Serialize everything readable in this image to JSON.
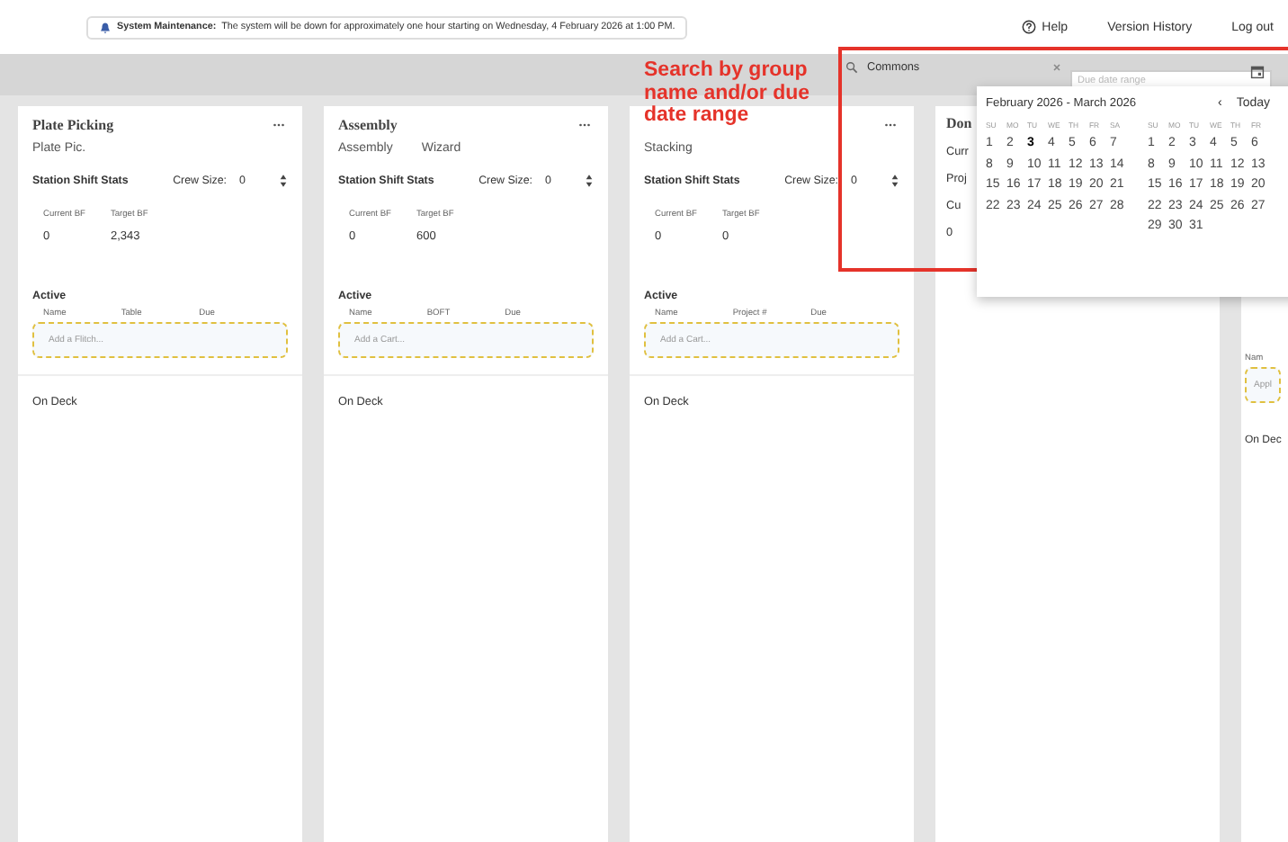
{
  "notice": {
    "label": "System Maintenance:",
    "text": "The system will be down for approximately one hour starting on Wednesday, 4 February 2026 at 1:00 PM."
  },
  "nav": [
    "Help",
    "Version History",
    "Log out"
  ],
  "annotation": "Search by group name and/or due date range",
  "search": {
    "value": "Commons"
  },
  "date_range": {
    "placeholder": "Due date range"
  },
  "calendar": {
    "title": "February 2026 - March 2026",
    "prev": "‹",
    "today": "Today",
    "months": [
      {
        "weekdays": [
          "SU",
          "MO",
          "TU",
          "WE",
          "TH",
          "FR",
          "SA"
        ],
        "weeks": [
          [
            {
              "d": "1",
              "today": false
            },
            {
              "d": "2",
              "today": false
            },
            {
              "d": "3",
              "today": true
            },
            {
              "d": "4",
              "today": false
            },
            {
              "d": "5",
              "today": false
            },
            {
              "d": "6",
              "today": false
            },
            {
              "d": "7",
              "today": false
            }
          ],
          [
            {
              "d": "8",
              "today": false
            },
            {
              "d": "9",
              "today": false
            },
            {
              "d": "10",
              "today": false
            },
            {
              "d": "11",
              "today": false
            },
            {
              "d": "12",
              "today": false
            },
            {
              "d": "13",
              "today": false
            },
            {
              "d": "14",
              "today": false
            }
          ],
          [
            {
              "d": "15",
              "today": false
            },
            {
              "d": "16",
              "today": false
            },
            {
              "d": "17",
              "today": false
            },
            {
              "d": "18",
              "today": false
            },
            {
              "d": "19",
              "today": false
            },
            {
              "d": "20",
              "today": false
            },
            {
              "d": "21",
              "today": false
            }
          ],
          [
            {
              "d": "22",
              "today": false
            },
            {
              "d": "23",
              "today": false
            },
            {
              "d": "24",
              "today": false
            },
            {
              "d": "25",
              "today": false
            },
            {
              "d": "26",
              "today": false
            },
            {
              "d": "27",
              "today": false
            },
            {
              "d": "28",
              "today": false
            }
          ]
        ]
      },
      {
        "weekdays": [
          "SU",
          "MO",
          "TU",
          "WE",
          "TH",
          "FR"
        ],
        "weeks": [
          [
            {
              "d": "1",
              "today": false
            },
            {
              "d": "2",
              "today": false
            },
            {
              "d": "3",
              "today": false
            },
            {
              "d": "4",
              "today": false
            },
            {
              "d": "5",
              "today": false
            },
            {
              "d": "6",
              "today": false
            }
          ],
          [
            {
              "d": "8",
              "today": false
            },
            {
              "d": "9",
              "today": false
            },
            {
              "d": "10",
              "today": false
            },
            {
              "d": "11",
              "today": false
            },
            {
              "d": "12",
              "today": false
            },
            {
              "d": "13",
              "today": false
            }
          ],
          [
            {
              "d": "15",
              "today": false
            },
            {
              "d": "16",
              "today": false
            },
            {
              "d": "17",
              "today": false
            },
            {
              "d": "18",
              "today": false
            },
            {
              "d": "19",
              "today": false
            },
            {
              "d": "20",
              "today": false
            }
          ],
          [
            {
              "d": "22",
              "today": false
            },
            {
              "d": "23",
              "today": false
            },
            {
              "d": "24",
              "today": false
            },
            {
              "d": "25",
              "today": false
            },
            {
              "d": "26",
              "today": false
            },
            {
              "d": "27",
              "today": false
            }
          ],
          [
            {
              "d": "29",
              "today": false
            },
            {
              "d": "30",
              "today": false
            },
            {
              "d": "31",
              "today": false
            }
          ]
        ]
      }
    ]
  },
  "columns": [
    {
      "kind": "full",
      "title": "Plate Picking",
      "tabs": [
        "Plate Pic."
      ],
      "stats_title": "Station Shift Stats",
      "crew_label": "Crew Size:",
      "crew_value": "0",
      "stats": [
        {
          "label": "Current BF",
          "value": "0"
        },
        {
          "label": "Target BF",
          "value": "2,343"
        }
      ],
      "active": "Active",
      "headers": [
        "Name",
        "Table",
        "Due"
      ],
      "add_placeholder": "Add a Flitch...",
      "on_deck": "On Deck"
    },
    {
      "kind": "full",
      "title": "Assembly",
      "tabs": [
        "Assembly",
        "Wizard"
      ],
      "stats_title": "Station Shift Stats",
      "crew_label": "Crew Size:",
      "crew_value": "0",
      "stats": [
        {
          "label": "Current BF",
          "value": "0"
        },
        {
          "label": "Target BF",
          "value": "600"
        }
      ],
      "active": "Active",
      "headers": [
        "Name",
        "BOFT",
        "Due"
      ],
      "add_placeholder": "Add a Cart...",
      "on_deck": "On Deck"
    },
    {
      "kind": "full",
      "tabs": [
        "Stacking"
      ],
      "stats_title": "Station Shift Stats",
      "crew_label": "Crew Size:",
      "crew_value": "0",
      "stats": [
        {
          "label": "Current BF",
          "value": "0"
        },
        {
          "label": "Target BF",
          "value": "0"
        }
      ],
      "active": "Active",
      "headers": [
        "Name",
        "Project #",
        "Due"
      ],
      "add_placeholder": "Add a Cart...",
      "on_deck": "On Deck"
    },
    {
      "kind": "covered",
      "title": "Don",
      "lines": [
        "Curr",
        "Proj",
        "Cu",
        "0"
      ]
    },
    {
      "kind": "edge",
      "header": "Nam",
      "add_placeholder": "Appl",
      "on_deck": "On Dec"
    }
  ]
}
